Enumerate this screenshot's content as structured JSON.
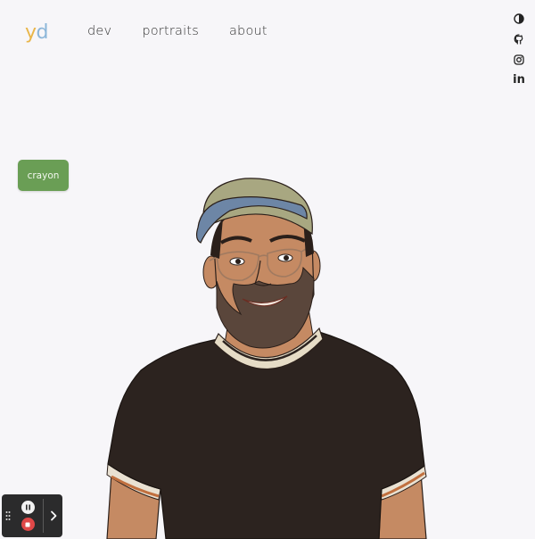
{
  "logo": {
    "first": "y",
    "second": "d"
  },
  "nav": {
    "items": [
      "dev",
      "portraits",
      "about"
    ]
  },
  "social": {
    "icons": [
      "theme-toggle-icon",
      "github-icon",
      "instagram-icon",
      "linkedin-icon"
    ],
    "linkedin_text": "in"
  },
  "crayon_button": {
    "label": "crayon",
    "color": "#6a9e55"
  },
  "recorder": {
    "icons": [
      "drag-grip-icon",
      "pause-icon",
      "stop-icon",
      "chevron-right-icon"
    ]
  },
  "colors": {
    "background": "#f7f6f9",
    "logo_y": "#e9b64a",
    "logo_d": "#8cb6d9",
    "shirt": "#2c231f",
    "skin": "#c58a63",
    "cap": "#a8a781",
    "cap_brim": "#6d86a6"
  }
}
